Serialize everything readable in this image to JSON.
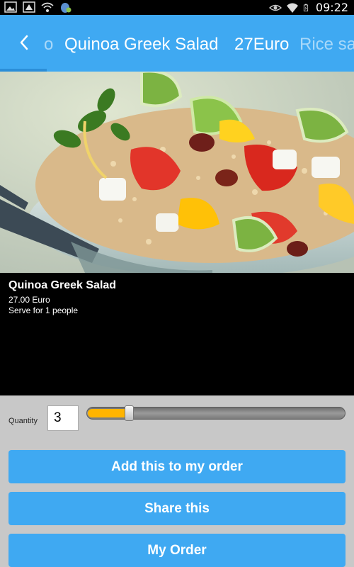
{
  "status_bar": {
    "time": "09:22",
    "left_icons": [
      "image-icon",
      "usb-debug-icon",
      "wifi-icon",
      "android-icon"
    ],
    "right_icons": [
      "eye-icon",
      "wifi-icon",
      "battery-charging-icon"
    ]
  },
  "action_bar": {
    "back_icon": "chevron-left-icon",
    "prev_fragment": "o",
    "title": "Quinoa Greek Salad",
    "price": "27Euro",
    "next_fragment": "Rice sa",
    "color": "#3fa9f2"
  },
  "dish": {
    "name": "Quinoa Greek Salad",
    "price": "27.00 Euro",
    "serves": "Serve for 1 people"
  },
  "quantity": {
    "label": "Quantity",
    "value": "3",
    "slider_fraction": 0.16,
    "slider_color": "#ffb400"
  },
  "buttons": {
    "add_order": "Add this to my order",
    "share": "Share this",
    "my_order": "My Order"
  }
}
